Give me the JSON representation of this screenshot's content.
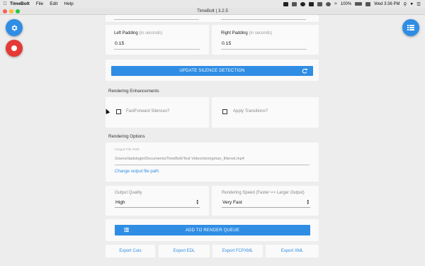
{
  "menubar": {
    "app_name": "TimeBolt",
    "items": [
      "File",
      "Edit",
      "Help"
    ],
    "battery": "100%",
    "clock": "Wed 3:36 PM"
  },
  "window": {
    "title": "TimeBolt | 3.2.5"
  },
  "padding": {
    "left_label": "Left Padding",
    "left_hint": "(in seconds)",
    "left_value": "0.15",
    "right_label": "Right Padding",
    "right_hint": "(in seconds)",
    "right_value": "0.15"
  },
  "update_button": {
    "label": "UPDATE SILENCE DETECTION",
    "icon": "refresh-icon"
  },
  "enhancements": {
    "title": "Rendering Enhancements",
    "fastforward_label": "FastForward Silences?",
    "transitions_label": "Apply Transitions?"
  },
  "options": {
    "title": "Rendering Options",
    "output_path_label": "Output File Path",
    "output_path": "/Users/dadslogin/Documents/TimeBolt/Test Video/strongman_filtered.mp4",
    "change_link": "Change output file path",
    "quality_label": "Output Quality",
    "quality_value": "High",
    "speed_label": "Rendering Speed (Faster => Larger Output)",
    "speed_value": "Very Fast"
  },
  "render_queue_button": {
    "label": "ADD TO RENDER QUEUE",
    "icon": "list-icon"
  },
  "exports": {
    "cuts": "Export Cuts",
    "edl": "Export EDL",
    "fcpxml": "Export FCPXML",
    "xml": "Export XML"
  },
  "colors": {
    "accent": "#2f8de4",
    "record": "#e53935"
  }
}
